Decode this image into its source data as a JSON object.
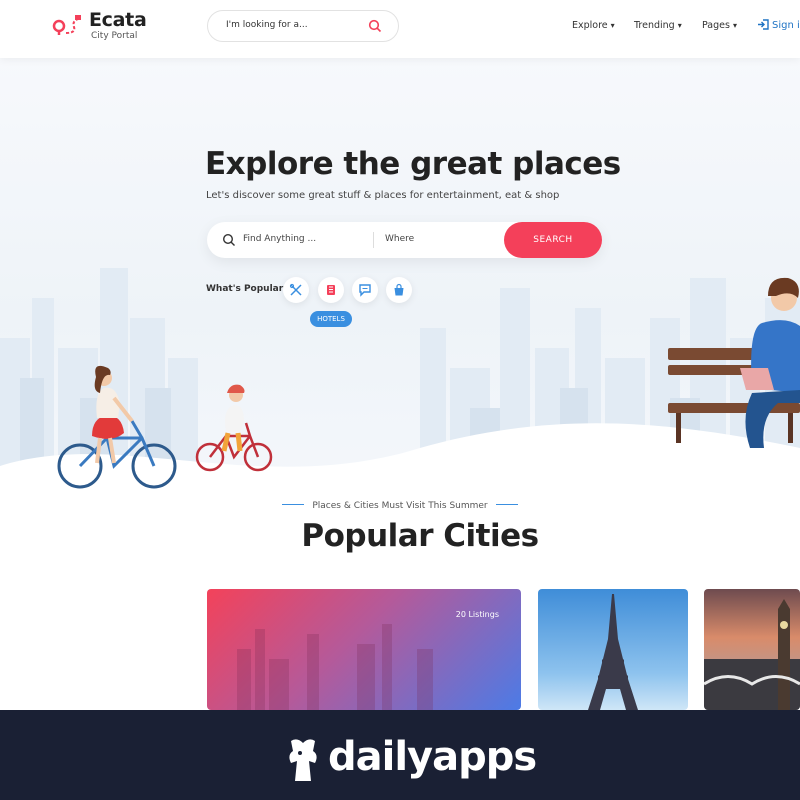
{
  "header": {
    "logo_name": "Ecata",
    "logo_sub": "City Portal",
    "search_placeholder": "I'm looking for a...",
    "nav": [
      "Explore",
      "Trending",
      "Pages"
    ],
    "signin": "Sign in"
  },
  "hero": {
    "title": "Explore the great places",
    "subtitle": "Let's discover some great stuff & places for entertainment, eat  & shop",
    "search": {
      "find_placeholder": "Find Anything ...",
      "where_placeholder": "Where",
      "button": "SEARCH"
    },
    "popular_label": "What's Popular",
    "categories": [
      {
        "icon": "restaurant-icon"
      },
      {
        "icon": "hotel-icon",
        "active": true
      },
      {
        "icon": "chat-icon"
      },
      {
        "icon": "shopping-bag-icon"
      }
    ],
    "active_tooltip": "HOTELS"
  },
  "section": {
    "eyebrow": "Places & Cities Must Visit This Summer",
    "title": "Popular Cities"
  },
  "cities": [
    {
      "listings": "20 Listings"
    },
    {
      "landmark": "eiffel-tower"
    },
    {
      "landmark": "big-ben"
    }
  ],
  "banner": {
    "brand": "dailyapps"
  },
  "colors": {
    "accent": "#f4405a",
    "blue": "#3a8fe0",
    "banner": "#1a2034"
  }
}
